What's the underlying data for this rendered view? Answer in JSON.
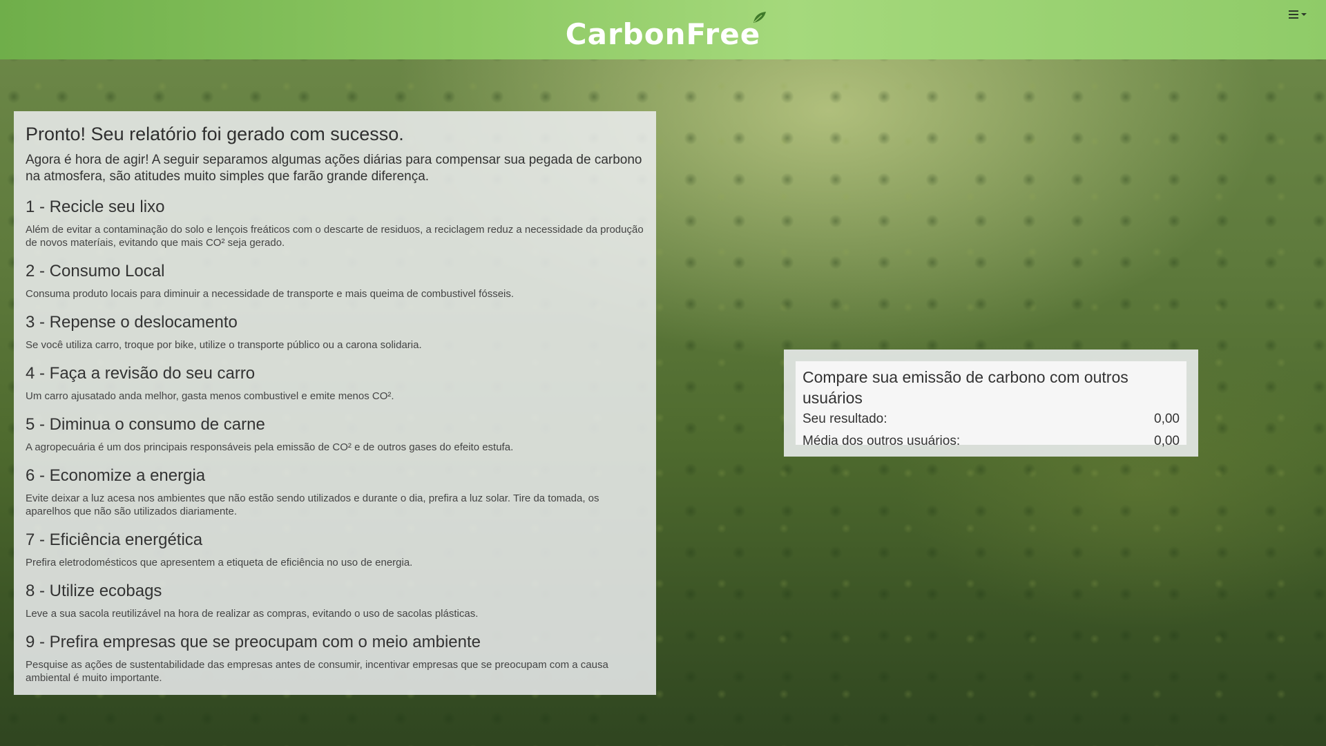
{
  "header": {
    "logo_text": "CarbonFree",
    "brand_color": "#8cc862",
    "menu_icon": "hamburger-icon"
  },
  "report": {
    "title": "Pronto! Seu relatório foi gerado com sucesso.",
    "intro": "Agora é hora de agir! A seguir separamos algumas ações diárias para compensar sua pegada de carbono na atmosfera, são atitudes muito simples que farão grande diferença.",
    "tips": [
      {
        "title": "1 - Recicle seu lixo",
        "text": "Além de evitar a contaminação do solo e lençois freáticos com o descarte de residuos, a reciclagem reduz a necessidade da produção de novos materíais, evitando que mais CO² seja gerado."
      },
      {
        "title": "2 - Consumo Local",
        "text": "Consuma produto locais para diminuir a necessidade de transporte e mais queima de combustivel fósseis."
      },
      {
        "title": "3 - Repense o deslocamento",
        "text": "Se você utiliza carro, troque por bike, utilize o transporte público ou a carona solidaria."
      },
      {
        "title": "4 - Faça a revisão do seu carro",
        "text": "Um carro ajusatado anda melhor, gasta menos combustivel e emite menos CO²."
      },
      {
        "title": "5 - Diminua o consumo de carne",
        "text": "A agropecuária é um dos principais responsáveis pela emissão de CO² e de outros gases do efeito estufa."
      },
      {
        "title": "6 - Economize a energia",
        "text": "Evite deixar a luz acesa nos ambientes que não estão sendo utilizados e durante o dia, prefira a luz solar. Tire da tomada, os aparelhos que não são utilizados diariamente."
      },
      {
        "title": "7 - Eficiência energética",
        "text": "Prefira eletrodomésticos que apresentem a etiqueta de eficiência no uso de energia."
      },
      {
        "title": "8 - Utilize ecobags",
        "text": "Leve a sua sacola reutilizável na hora de realizar as compras, evitando o uso de sacolas plásticas."
      },
      {
        "title": "9 - Prefira empresas que se preocupam com o meio ambiente",
        "text": "Pesquise as ações de sustentabilidade das empresas antes de consumir, incentivar empresas que se preocupam com a causa ambiental é muito importante."
      }
    ]
  },
  "comparison": {
    "title": "Compare sua emissão de carbono com outros usuários",
    "your_result_label": "Seu resultado:",
    "your_result_value": "0,00",
    "others_label": "Média dos outros usuários:",
    "others_value": "0,00"
  }
}
